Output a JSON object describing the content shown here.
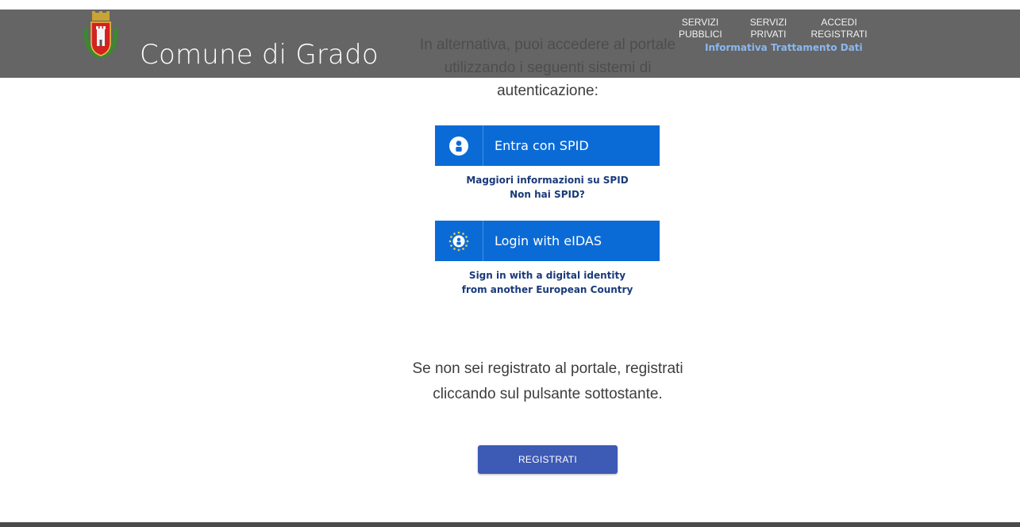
{
  "header": {
    "site_title": "Comune di Grado",
    "nav": [
      {
        "line1": "SERVIZI",
        "line2": "PUBBLICI"
      },
      {
        "line1": "SERVIZI",
        "line2": "PRIVATI"
      },
      {
        "line1": "ACCEDI",
        "line2": "REGISTRATI"
      }
    ],
    "privacy_link": "Informativa Trattamento Dati",
    "logo_icon": "coat-of-arms-icon"
  },
  "main": {
    "intro_text": "In alternativa, puoi accedere al portale utilizzando i seguenti sistemi di autenticazione:",
    "spid": {
      "button_label": "Entra con SPID",
      "icon": "user-icon",
      "links": [
        "Maggiori informazioni su SPID",
        "Non hai SPID?"
      ]
    },
    "eidas": {
      "button_label": "Login with eIDAS",
      "icon": "eu-user-icon",
      "links": [
        "Sign in with a digital identity",
        "from another European Country"
      ]
    },
    "register_text": "Se non sei registrato al portale, registrati cliccando sul pulsante sottostante.",
    "register_button": "REGISTRATI"
  },
  "colors": {
    "header_bg": "#505050",
    "auth_button": "#0b6bd6",
    "register_button": "#3d5ab5",
    "link_text": "#1a3a7a",
    "privacy_link": "#8ab8f0"
  }
}
